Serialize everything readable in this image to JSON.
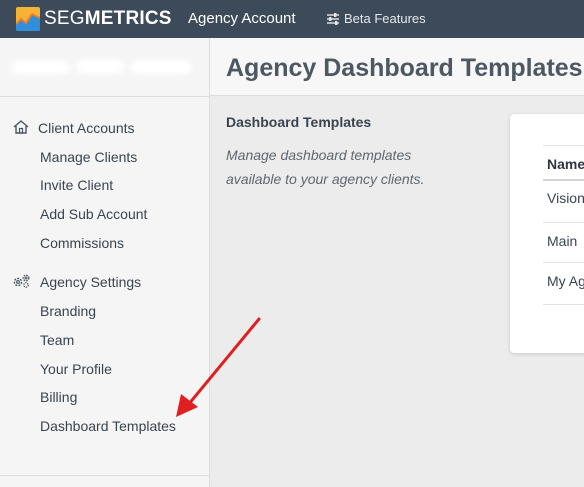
{
  "topbar": {
    "brand_light": "SEG",
    "brand_bold": "METRICS",
    "subtitle": "Agency Account",
    "beta_label": "Beta Features",
    "bg_color": "#3c4a5a"
  },
  "sidebar": {
    "client_accounts": {
      "heading": "Client Accounts",
      "icon": "home-icon",
      "items": [
        "Manage Clients",
        "Invite Client",
        "Add Sub Account",
        "Commissions"
      ]
    },
    "agency_settings": {
      "heading": "Agency Settings",
      "icon": "gears-icon",
      "items": [
        "Branding",
        "Team",
        "Your Profile",
        "Billing",
        "Dashboard Templates"
      ]
    }
  },
  "main": {
    "page_title": "Agency Dashboard Templates",
    "section_title": "Dashboard Templates",
    "section_description": "Manage dashboard templates available to your agency clients.",
    "table": {
      "column_header": "Name",
      "rows": [
        "Vision",
        "Main",
        "My Ag"
      ]
    }
  },
  "annotation": {
    "arrow_color": "#e02020"
  }
}
